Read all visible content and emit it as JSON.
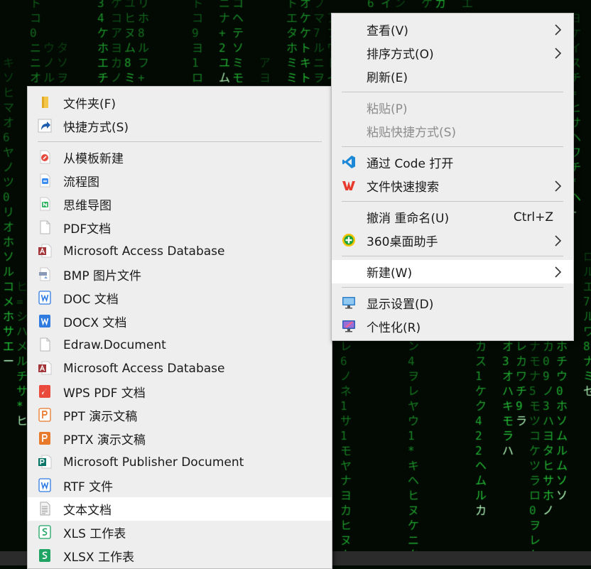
{
  "desktop": {
    "background": "matrix-code-rain",
    "glyph_color": "#27d33c"
  },
  "context_menu": {
    "items": [
      {
        "label": "查看(V)",
        "submenu": true
      },
      {
        "label": "排序方式(O)",
        "submenu": true
      },
      {
        "label": "刷新(E)"
      },
      {
        "label": "粘贴(P)",
        "disabled": true
      },
      {
        "label": "粘贴快捷方式(S)",
        "disabled": true
      },
      {
        "label": "通过 Code 打开",
        "icon": "vscode-icon"
      },
      {
        "label": "文件快速搜索",
        "icon": "wps-icon",
        "submenu": true
      },
      {
        "label": "撤消 重命名(U)",
        "shortcut": "Ctrl+Z"
      },
      {
        "label": "360桌面助手",
        "icon": "360-assistant-icon",
        "submenu": true
      },
      {
        "label": "新建(W)",
        "submenu": true,
        "highlighted": true
      },
      {
        "label": "显示设置(D)",
        "icon": "display-settings-icon"
      },
      {
        "label": "个性化(R)",
        "icon": "personalize-icon"
      }
    ]
  },
  "new_submenu": {
    "items": [
      {
        "label": "文件夹(F)",
        "icon": "folder-icon"
      },
      {
        "label": "快捷方式(S)",
        "icon": "shortcut-icon"
      },
      {
        "label": "从模板新建",
        "icon": "template-icon"
      },
      {
        "label": "流程图",
        "icon": "flowchart-icon"
      },
      {
        "label": "思维导图",
        "icon": "mindmap-icon"
      },
      {
        "label": "PDF文档",
        "icon": "blank-file-icon"
      },
      {
        "label": "Microsoft Access Database",
        "icon": "access-icon"
      },
      {
        "label": "BMP 图片文件",
        "icon": "bmp-file-icon"
      },
      {
        "label": "DOC 文档",
        "icon": "doc-icon"
      },
      {
        "label": "DOCX 文档",
        "icon": "docx-icon"
      },
      {
        "label": "Edraw.Document",
        "icon": "blank-file-icon"
      },
      {
        "label": "Microsoft Access Database",
        "icon": "access-icon"
      },
      {
        "label": "WPS PDF 文档",
        "icon": "wps-pdf-icon"
      },
      {
        "label": "PPT 演示文稿",
        "icon": "ppt-icon"
      },
      {
        "label": "PPTX 演示文稿",
        "icon": "pptx-icon"
      },
      {
        "label": "Microsoft Publisher Document",
        "icon": "publisher-icon"
      },
      {
        "label": "RTF 文件",
        "icon": "rtf-icon"
      },
      {
        "label": "文本文档",
        "icon": "text-file-icon",
        "highlighted": true
      },
      {
        "label": "XLS 工作表",
        "icon": "xls-icon"
      },
      {
        "label": "XLSX 工作表",
        "icon": "xlsx-icon"
      }
    ]
  }
}
